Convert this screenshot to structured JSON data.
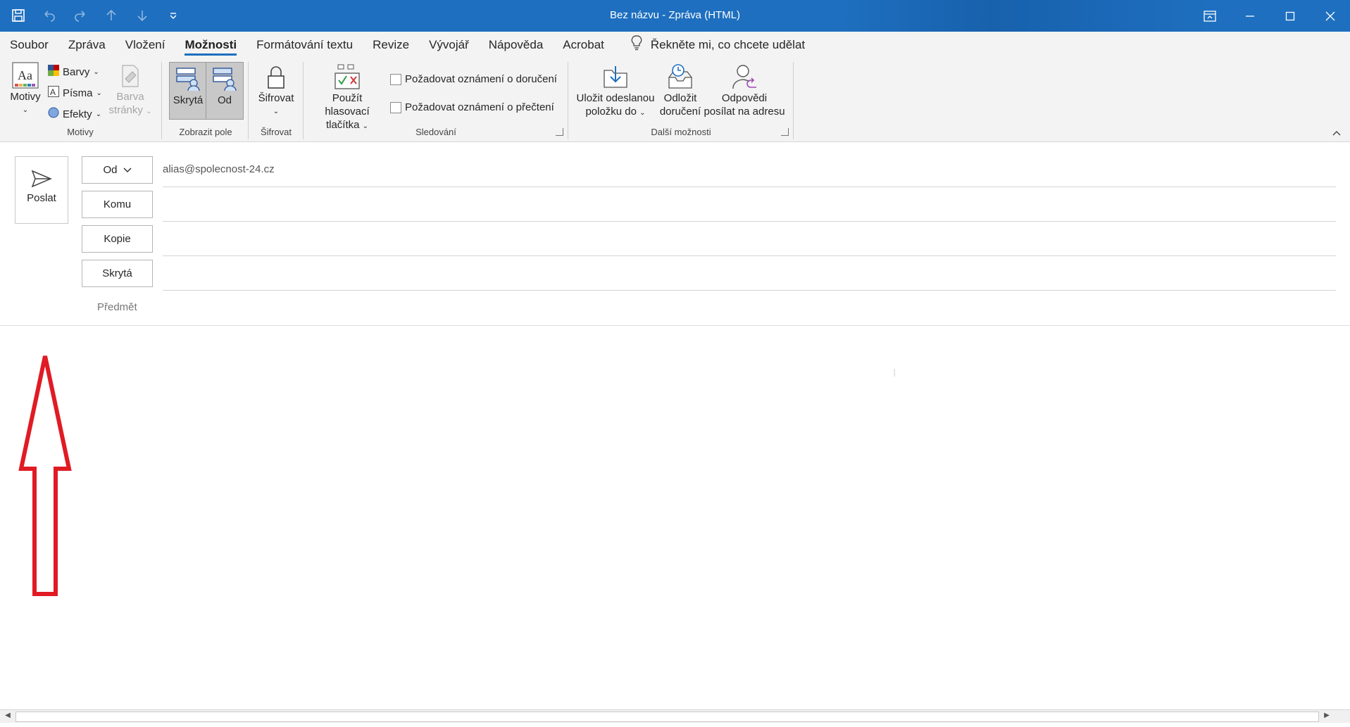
{
  "window": {
    "title": "Bez názvu  -  Zpráva (HTML)"
  },
  "colors": {
    "accent": "#1e6fbf",
    "annotation": "#e01b24"
  },
  "menu": {
    "items": [
      "Soubor",
      "Zpráva",
      "Vložení",
      "Možnosti",
      "Formátování textu",
      "Revize",
      "Vývojář",
      "Nápověda",
      "Acrobat"
    ],
    "active": "Možnosti",
    "tell_me": "Řekněte mi, co chcete udělat"
  },
  "ribbon": {
    "groups": {
      "motivy": {
        "label": "Motivy",
        "motivy_btn": "Motivy",
        "barvy": "Barvy",
        "pisma": "Písma",
        "efekty": "Efekty",
        "barva_line1": "Barva",
        "barva_line2": "stránky"
      },
      "zobrazit_pole": {
        "label": "Zobrazit pole",
        "skryta": "Skrytá",
        "od": "Od"
      },
      "sifrovat": {
        "label": "Šifrovat",
        "btn": "Šifrovat"
      },
      "sledovani": {
        "label": "Sledování",
        "hlas_line1": "Použít hlasovací",
        "hlas_line2": "tlačítka",
        "dorucenka": "Požadovat oznámení o doručení",
        "precteni": "Požadovat oznámení o přečtení"
      },
      "dalsi": {
        "label": "Další možnosti",
        "ulozit_line1": "Uložit odeslanou",
        "ulozit_line2": "položku do",
        "odlozit_line1": "Odložit",
        "odlozit_line2": "doručení",
        "odpovedi_line1": "Odpovědi",
        "odpovedi_line2": "posílat na adresu"
      }
    }
  },
  "compose": {
    "send": "Poslat",
    "from_btn": "Od",
    "from_value": "alias@spolecnost-24.cz",
    "to_btn": "Komu",
    "cc_btn": "Kopie",
    "bcc_btn": "Skrytá",
    "subject_label": "Předmět"
  }
}
